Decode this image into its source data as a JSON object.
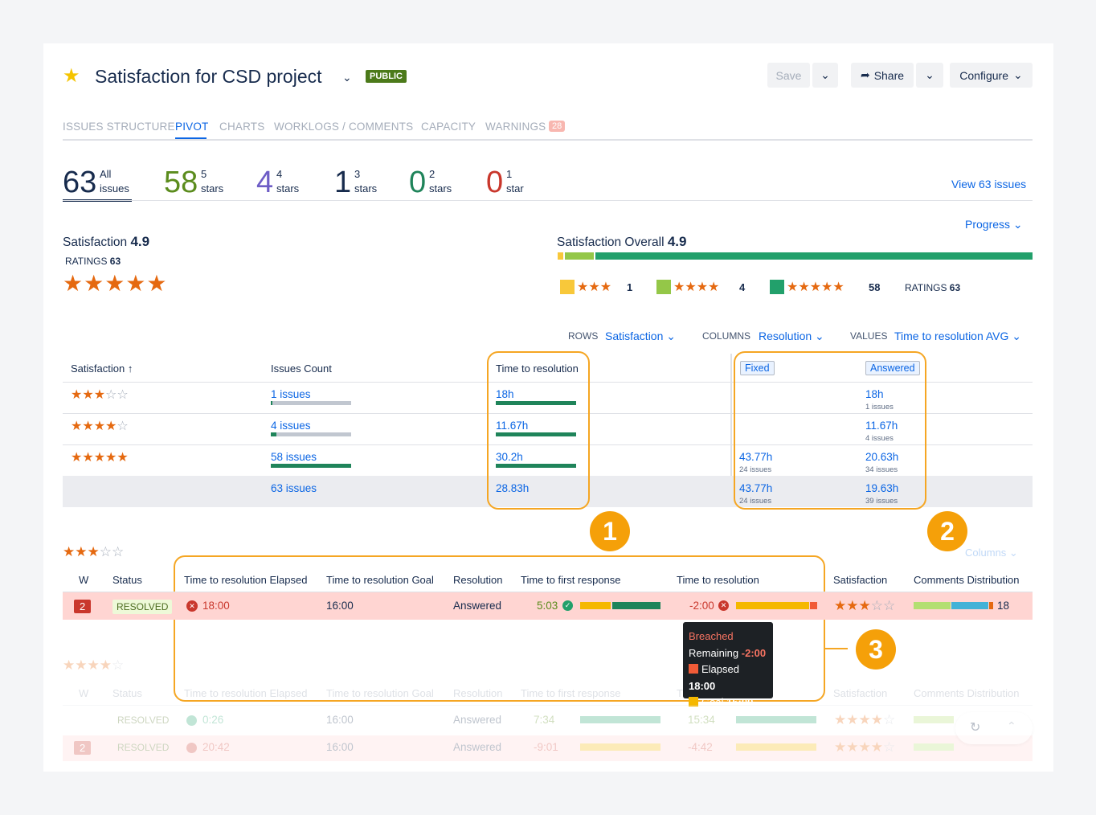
{
  "header": {
    "title": "Satisfaction for CSD project",
    "badge": "PUBLIC",
    "save": "Save",
    "share": "Share",
    "configure": "Configure"
  },
  "tabs": [
    "ISSUES STRUCTURE",
    "PIVOT",
    "CHARTS",
    "WORKLOGS / COMMENTS",
    "CAPACITY",
    "WARNINGS"
  ],
  "warnings_count": "28",
  "stats": [
    {
      "num": "63",
      "l1": "All",
      "l2": "issues",
      "color": "#172b4d"
    },
    {
      "num": "58",
      "l1": "5",
      "l2": "stars",
      "color": "#5b8c1d"
    },
    {
      "num": "4",
      "l1": "4",
      "l2": "stars",
      "color": "#6e5dc6"
    },
    {
      "num": "1",
      "l1": "3",
      "l2": "stars",
      "color": "#172b4d"
    },
    {
      "num": "0",
      "l1": "2",
      "l2": "stars",
      "color": "#1f845a"
    },
    {
      "num": "0",
      "l1": "1",
      "l2": "star",
      "color": "#c9372c"
    }
  ],
  "view_issues": "View 63 issues",
  "progress": "Progress",
  "satisfaction": {
    "label": "Satisfaction",
    "value": "4.9",
    "ratings_label": "RATINGS",
    "ratings": "63"
  },
  "overall": {
    "label": "Satisfaction Overall",
    "value": "4.9",
    "legend": [
      {
        "count": "1",
        "color": "#f8c83a",
        "stars": 3
      },
      {
        "count": "4",
        "color": "#94c748",
        "stars": 4
      },
      {
        "count": "58",
        "color": "#22a06b",
        "stars": 5
      }
    ],
    "ratings_label": "RATINGS",
    "ratings": "63",
    "bar": [
      {
        "fraction": 0.016,
        "color": "#f8c83a"
      },
      {
        "fraction": 0.063,
        "color": "#94c748"
      },
      {
        "fraction": 0.921,
        "color": "#22a06b"
      }
    ]
  },
  "pivot": {
    "rows_label": "ROWS",
    "rows_value": "Satisfaction",
    "columns_label": "COLUMNS",
    "columns_value": "Resolution",
    "values_label": "VALUES",
    "values_value": "Time to resolution AVG",
    "headers": {
      "satisfaction": "Satisfaction",
      "count": "Issues Count",
      "ttr": "Time to resolution",
      "fixed": "Fixed",
      "answered": "Answered"
    },
    "rows": [
      {
        "stars": 3,
        "count": "1 issues",
        "count_frac": 0.017,
        "ttr": "18h",
        "fixed": "",
        "fixed_sub": "",
        "answered": "18h",
        "answered_sub": "1 issues"
      },
      {
        "stars": 4,
        "count": "4 issues",
        "count_frac": 0.07,
        "ttr": "11.67h",
        "fixed": "",
        "fixed_sub": "",
        "answered": "11.67h",
        "answered_sub": "4 issues"
      },
      {
        "stars": 5,
        "count": "58 issues",
        "count_frac": 1.0,
        "ttr": "30.2h",
        "fixed": "43.77h",
        "fixed_sub": "24 issues",
        "answered": "20.63h",
        "answered_sub": "34 issues"
      }
    ],
    "total": {
      "count": "63 issues",
      "ttr": "28.83h",
      "fixed": "43.77h",
      "fixed_sub": "24 issues",
      "answered": "19.63h",
      "answered_sub": "39 issues"
    }
  },
  "callouts": [
    "1",
    "2",
    "3"
  ],
  "detail": {
    "columns_btn": "Columns",
    "headers": [
      "W",
      "Status",
      "Time to resolution Elapsed",
      "Time to resolution Goal",
      "Resolution",
      "Time to first response",
      "Time to resolution",
      "Satisfaction",
      "Comments Distribution"
    ],
    "row": {
      "w": "2",
      "status": "RESOLVED",
      "elapsed": "18:00",
      "goal": "16:00",
      "resolution": "Answered",
      "first": "5:03",
      "ttr": "-2:00",
      "comments": "18"
    },
    "tooltip": {
      "title": "Breached",
      "remaining_label": "Remaining",
      "remaining": "-2:00",
      "elapsed_label": "Elapsed",
      "elapsed": "18:00",
      "goal_label": "Goal",
      "goal": "16:00"
    }
  },
  "faded": {
    "headers": [
      "W",
      "Status",
      "Time to resolution Elapsed",
      "Time to resolution Goal",
      "Resolution",
      "Time to first response",
      "T",
      "Satisfaction",
      "Comments Distribution"
    ],
    "rows": [
      {
        "w": "",
        "status": "RESOLVED",
        "elapsed": "0:26",
        "goal": "16:00",
        "resolution": "Answered",
        "first": "7:34",
        "ttr": "15:34"
      },
      {
        "w": "2",
        "status": "RESOLVED",
        "elapsed": "20:42",
        "goal": "16:00",
        "resolution": "Answered",
        "first": "-9:01",
        "ttr": "-4:42"
      }
    ]
  }
}
